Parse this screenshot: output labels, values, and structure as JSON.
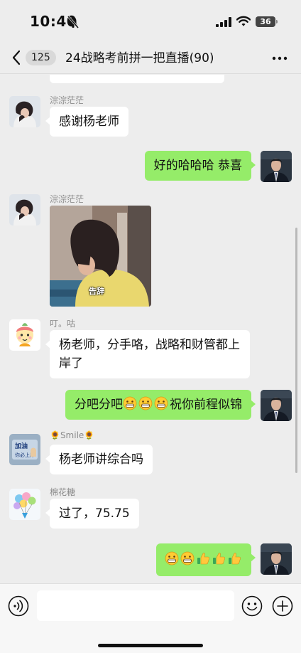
{
  "status_bar": {
    "time": "10:40",
    "battery": "36"
  },
  "nav": {
    "back_count": "125",
    "title": "24战略考前拼一把直播(90)"
  },
  "messages": [
    {
      "sender": "淙淙茫茫",
      "text": "感谢杨老师"
    },
    {
      "sender": "",
      "text": "好的哈哈哈 恭喜"
    },
    {
      "sender": "淙淙茫茫",
      "image_caption": "告辞"
    },
    {
      "sender": "叮。咕",
      "text": "杨老师，分手咯，战略和财管都上岸了"
    },
    {
      "sender": "",
      "text_before": "分吧分吧",
      "text_after": "祝你前程似锦"
    },
    {
      "sender": "🌻Smile🌻",
      "text": "杨老师讲综合吗"
    },
    {
      "sender": "棉花糖",
      "text": "过了，75.75"
    },
    {
      "sender": "",
      "emojis": [
        "grin",
        "grin",
        "thumbs-up",
        "thumbs-up",
        "thumbs-up"
      ]
    }
  ],
  "avatars": {
    "cat_text_line1": "加油",
    "cat_text_line2": "你必上岸"
  },
  "colors": {
    "background": "#ededed",
    "outgoing_bubble": "#95ec69",
    "incoming_bubble": "#ffffff"
  },
  "input": {
    "placeholder": ""
  }
}
